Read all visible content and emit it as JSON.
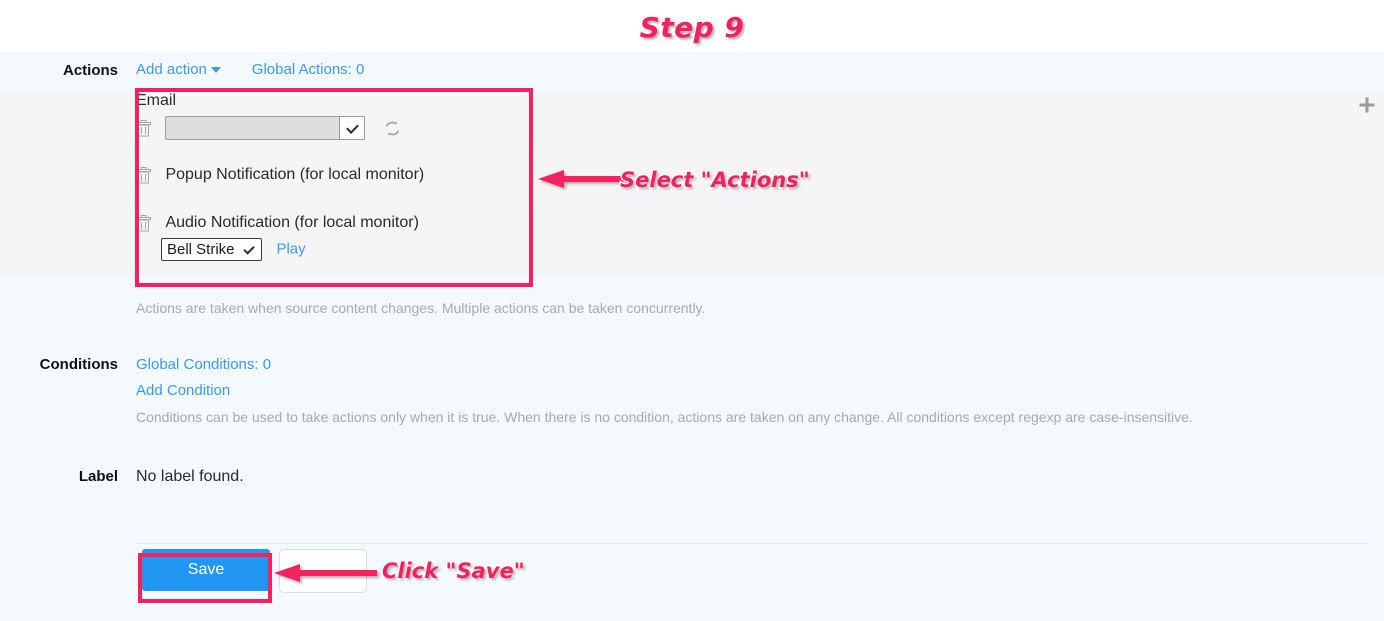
{
  "step_title": "Step 9",
  "actions": {
    "label": "Actions",
    "add_action_label": "Add action",
    "global_actions_label": "Global Actions: 0",
    "add_icon": "plus-icon",
    "items": [
      {
        "title": "Email",
        "type": "select",
        "select_value": "",
        "delete_icon": "trash-icon",
        "refresh_icon": "sync-icon"
      },
      {
        "title": "Popup Notification (for local monitor)",
        "type": "plain",
        "delete_icon": "trash-icon"
      },
      {
        "title": "Audio Notification (for local monitor)",
        "type": "audio",
        "delete_icon": "trash-icon",
        "sound_value": "Bell Strike",
        "play_label": "Play"
      }
    ],
    "help": "Actions are taken when source content changes. Multiple actions can be taken concurrently."
  },
  "conditions": {
    "label": "Conditions",
    "global_conditions_label": "Global Conditions: 0",
    "add_condition_label": "Add Condition",
    "help": "Conditions can be used to take actions only when it is true. When there is no condition, actions are taken on any change. All conditions except regexp are case-insensitive."
  },
  "label_section": {
    "label": "Label",
    "value": "No label found."
  },
  "footer": {
    "save_label": "Save",
    "blank_label": ""
  },
  "annotations": {
    "select_actions": "Select \"Actions\"",
    "click_save": "Click \"Save\""
  },
  "colors": {
    "accent_pink": "#f4215e",
    "link_blue": "#3c9ae8",
    "save_blue": "#2196f3",
    "page_bg": "#f4f9fe",
    "row_bg": "#f5f5f5",
    "help_gray": "#a9a9a9"
  }
}
